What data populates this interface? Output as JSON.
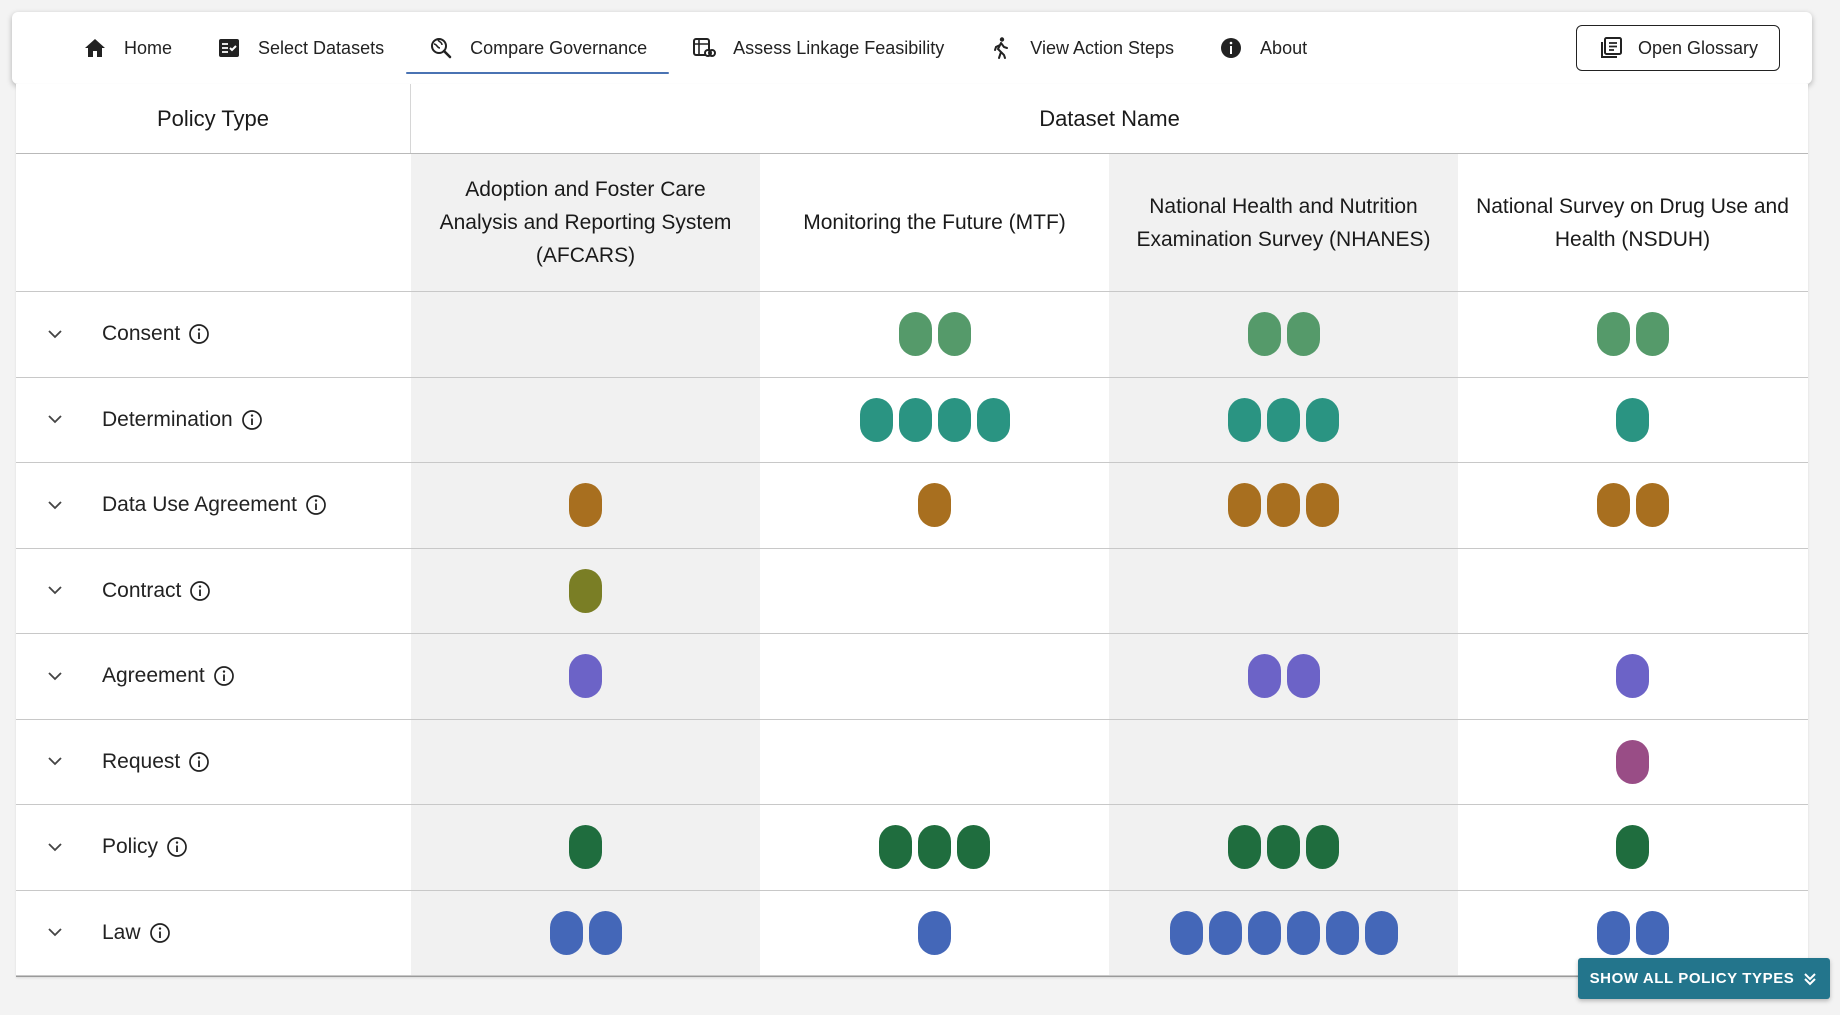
{
  "nav": {
    "items": [
      {
        "label": "Home",
        "icon": "home-icon",
        "active": false
      },
      {
        "label": "Select Datasets",
        "icon": "checklist-icon",
        "active": false
      },
      {
        "label": "Compare Governance",
        "icon": "search-globe-icon",
        "active": true
      },
      {
        "label": "Assess Linkage Feasibility",
        "icon": "linked-table-icon",
        "active": false
      },
      {
        "label": "View Action Steps",
        "icon": "walking-person-icon",
        "active": false
      },
      {
        "label": "About",
        "icon": "info-icon",
        "active": false
      }
    ],
    "glossary_label": "Open Glossary",
    "glossary_icon": "book-icon"
  },
  "table": {
    "policy_type_header": "Policy Type",
    "dataset_name_header": "Dataset Name",
    "datasets": [
      "Adoption and Foster Care Analysis and Reporting System (AFCARS)",
      "Monitoring the Future (MTF)",
      "National Health and Nutrition Examination Survey (NHANES)",
      "National Survey on Drug Use and Health (NSDUH)"
    ],
    "rows": [
      {
        "label": "Consent",
        "color": "#559a6a",
        "counts": [
          0,
          2,
          2,
          2
        ]
      },
      {
        "label": "Determination",
        "color": "#2a9482",
        "counts": [
          0,
          4,
          3,
          1
        ]
      },
      {
        "label": "Data Use Agreement",
        "color": "#a86f1f",
        "counts": [
          1,
          1,
          3,
          2
        ]
      },
      {
        "label": "Contract",
        "color": "#7a7e25",
        "counts": [
          1,
          0,
          0,
          0
        ]
      },
      {
        "label": "Agreement",
        "color": "#6c63c7",
        "counts": [
          1,
          0,
          2,
          1
        ]
      },
      {
        "label": "Request",
        "color": "#994d86",
        "counts": [
          0,
          0,
          0,
          1
        ]
      },
      {
        "label": "Policy",
        "color": "#1f6d3e",
        "counts": [
          1,
          3,
          3,
          1
        ]
      },
      {
        "label": "Law",
        "color": "#4467b8",
        "counts": [
          2,
          1,
          6,
          2
        ]
      }
    ]
  },
  "show_all_label": "SHOW ALL POLICY TYPES"
}
